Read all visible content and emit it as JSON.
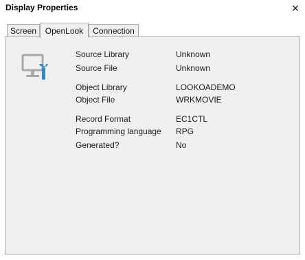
{
  "window": {
    "title": "Display Properties"
  },
  "tabs": [
    {
      "label": "Screen"
    },
    {
      "label": "OpenLook"
    },
    {
      "label": "Connection"
    }
  ],
  "properties": [
    {
      "label": "Source Library",
      "value": "Unknown"
    },
    {
      "label": "Source File",
      "value": "Unknown"
    },
    {
      "label": "Object Library",
      "value": "LOOKOADEMO"
    },
    {
      "label": "Object File",
      "value": "WRKMOVIE"
    },
    {
      "label": "Record Format",
      "value": "EC1CTL"
    },
    {
      "label": "Programming language",
      "value": "RPG"
    },
    {
      "label": "Generated?",
      "value": "No"
    }
  ],
  "icon": {
    "name": "monitor-wrench-icon",
    "monitor_color": "#a8a8a8",
    "wrench_color": "#2f88d2"
  }
}
